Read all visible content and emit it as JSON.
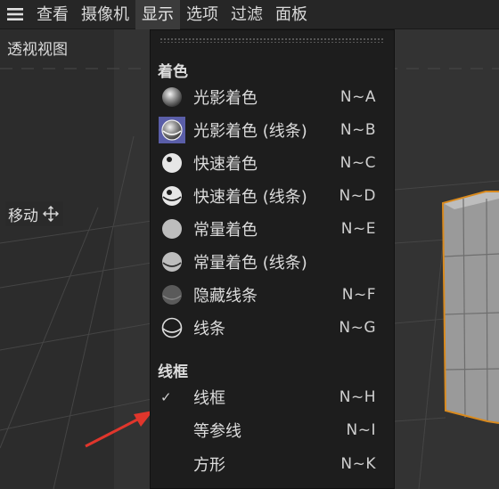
{
  "menubar": {
    "items": [
      {
        "label": "查看"
      },
      {
        "label": "摄像机"
      },
      {
        "label": "显示",
        "active": true
      },
      {
        "label": "选项"
      },
      {
        "label": "过滤"
      },
      {
        "label": "面板"
      }
    ]
  },
  "viewport": {
    "view_label": "透视视图",
    "move_label": "移动"
  },
  "dropdown": {
    "shading": {
      "title": "着色",
      "items": [
        {
          "label": "光影着色",
          "shortcut": "N~A",
          "icon": "gouraud-shading-icon"
        },
        {
          "label": "光影着色 (线条)",
          "shortcut": "N~B",
          "icon": "gouraud-lines-icon",
          "selected": true
        },
        {
          "label": "快速着色",
          "shortcut": "N~C",
          "icon": "quick-shading-icon"
        },
        {
          "label": "快速着色 (线条)",
          "shortcut": "N~D",
          "icon": "quick-lines-icon"
        },
        {
          "label": "常量着色",
          "shortcut": "N~E",
          "icon": "constant-shading-icon"
        },
        {
          "label": "常量着色 (线条)",
          "shortcut": "",
          "icon": "constant-lines-icon"
        },
        {
          "label": "隐藏线条",
          "shortcut": "N~F",
          "icon": "hidden-line-icon"
        },
        {
          "label": "线条",
          "shortcut": "N~G",
          "icon": "lines-icon"
        }
      ]
    },
    "wireframe": {
      "title": "线框",
      "items": [
        {
          "label": "线框",
          "shortcut": "N~H",
          "checked": true
        },
        {
          "label": "等参线",
          "shortcut": "N~I"
        },
        {
          "label": "方形",
          "shortcut": "N~K"
        }
      ]
    }
  },
  "colors": {
    "selected_bg": "#5a5ea8",
    "cube_outline": "#d98a1e",
    "arrow": "#e0362c"
  }
}
